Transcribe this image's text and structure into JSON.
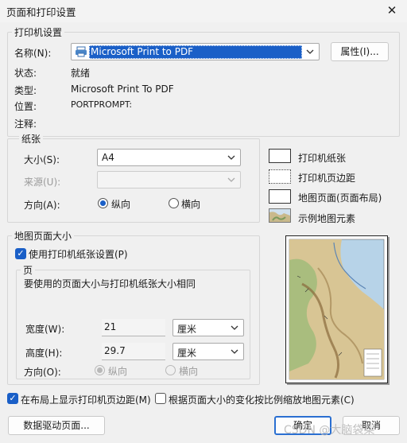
{
  "window": {
    "title": "页面和打印设置",
    "close_glyph": "✕"
  },
  "printer": {
    "group_label": "打印机设置",
    "name_label": "名称(N):",
    "name_value": "Microsoft Print to PDF",
    "properties_button": "属性(I)...",
    "status_label": "状态:",
    "status_value": "就绪",
    "type_label": "类型:",
    "type_value": "Microsoft Print To PDF",
    "location_label": "位置:",
    "location_value": "PORTPROMPT:",
    "comment_label": "注释:",
    "comment_value": ""
  },
  "paper": {
    "group_label": "纸张",
    "size_label": "大小(S):",
    "size_value": "A4",
    "source_label": "来源(U):",
    "source_value": "",
    "orientation_label": "方向(A):",
    "portrait_label": "纵向",
    "landscape_label": "横向",
    "orientation_selected": "portrait"
  },
  "legend": {
    "items": [
      {
        "label": "打印机纸张",
        "icon": "printer-paper-icon"
      },
      {
        "label": "打印机页边距",
        "icon": "printer-margin-icon"
      },
      {
        "label": "地图页面(页面布局)",
        "icon": "map-page-icon"
      },
      {
        "label": "示例地图元素",
        "icon": "sample-map-element-icon"
      }
    ]
  },
  "map_page": {
    "group_label": "地图页面大小",
    "use_printer_paper_label": "使用打印机纸张设置(P)",
    "use_printer_paper_checked": true,
    "page_group_label": "页",
    "page_note": "要使用的页面大小与打印机纸张大小相同",
    "width_label": "宽度(W):",
    "width_value": "21",
    "width_unit": "厘米",
    "height_label": "高度(H):",
    "height_value": "29.7",
    "height_unit": "厘米",
    "orientation_label": "方向(O):",
    "portrait_label": "纵向",
    "landscape_label": "横向",
    "orientation_selected": "portrait"
  },
  "options": {
    "show_margins_label": "在布局上显示打印机页边距(M)",
    "show_margins_checked": true,
    "scale_elements_label": "根据页面大小的变化按比例缩放地图元素(C)",
    "scale_elements_checked": false
  },
  "buttons": {
    "data_driven": "数据驱动页面...",
    "ok": "确定",
    "cancel": "取消"
  },
  "watermark": "CSDN @大脑袋梨",
  "colors": {
    "accent": "#1a5fc7",
    "selection": "#1a5fc7"
  }
}
